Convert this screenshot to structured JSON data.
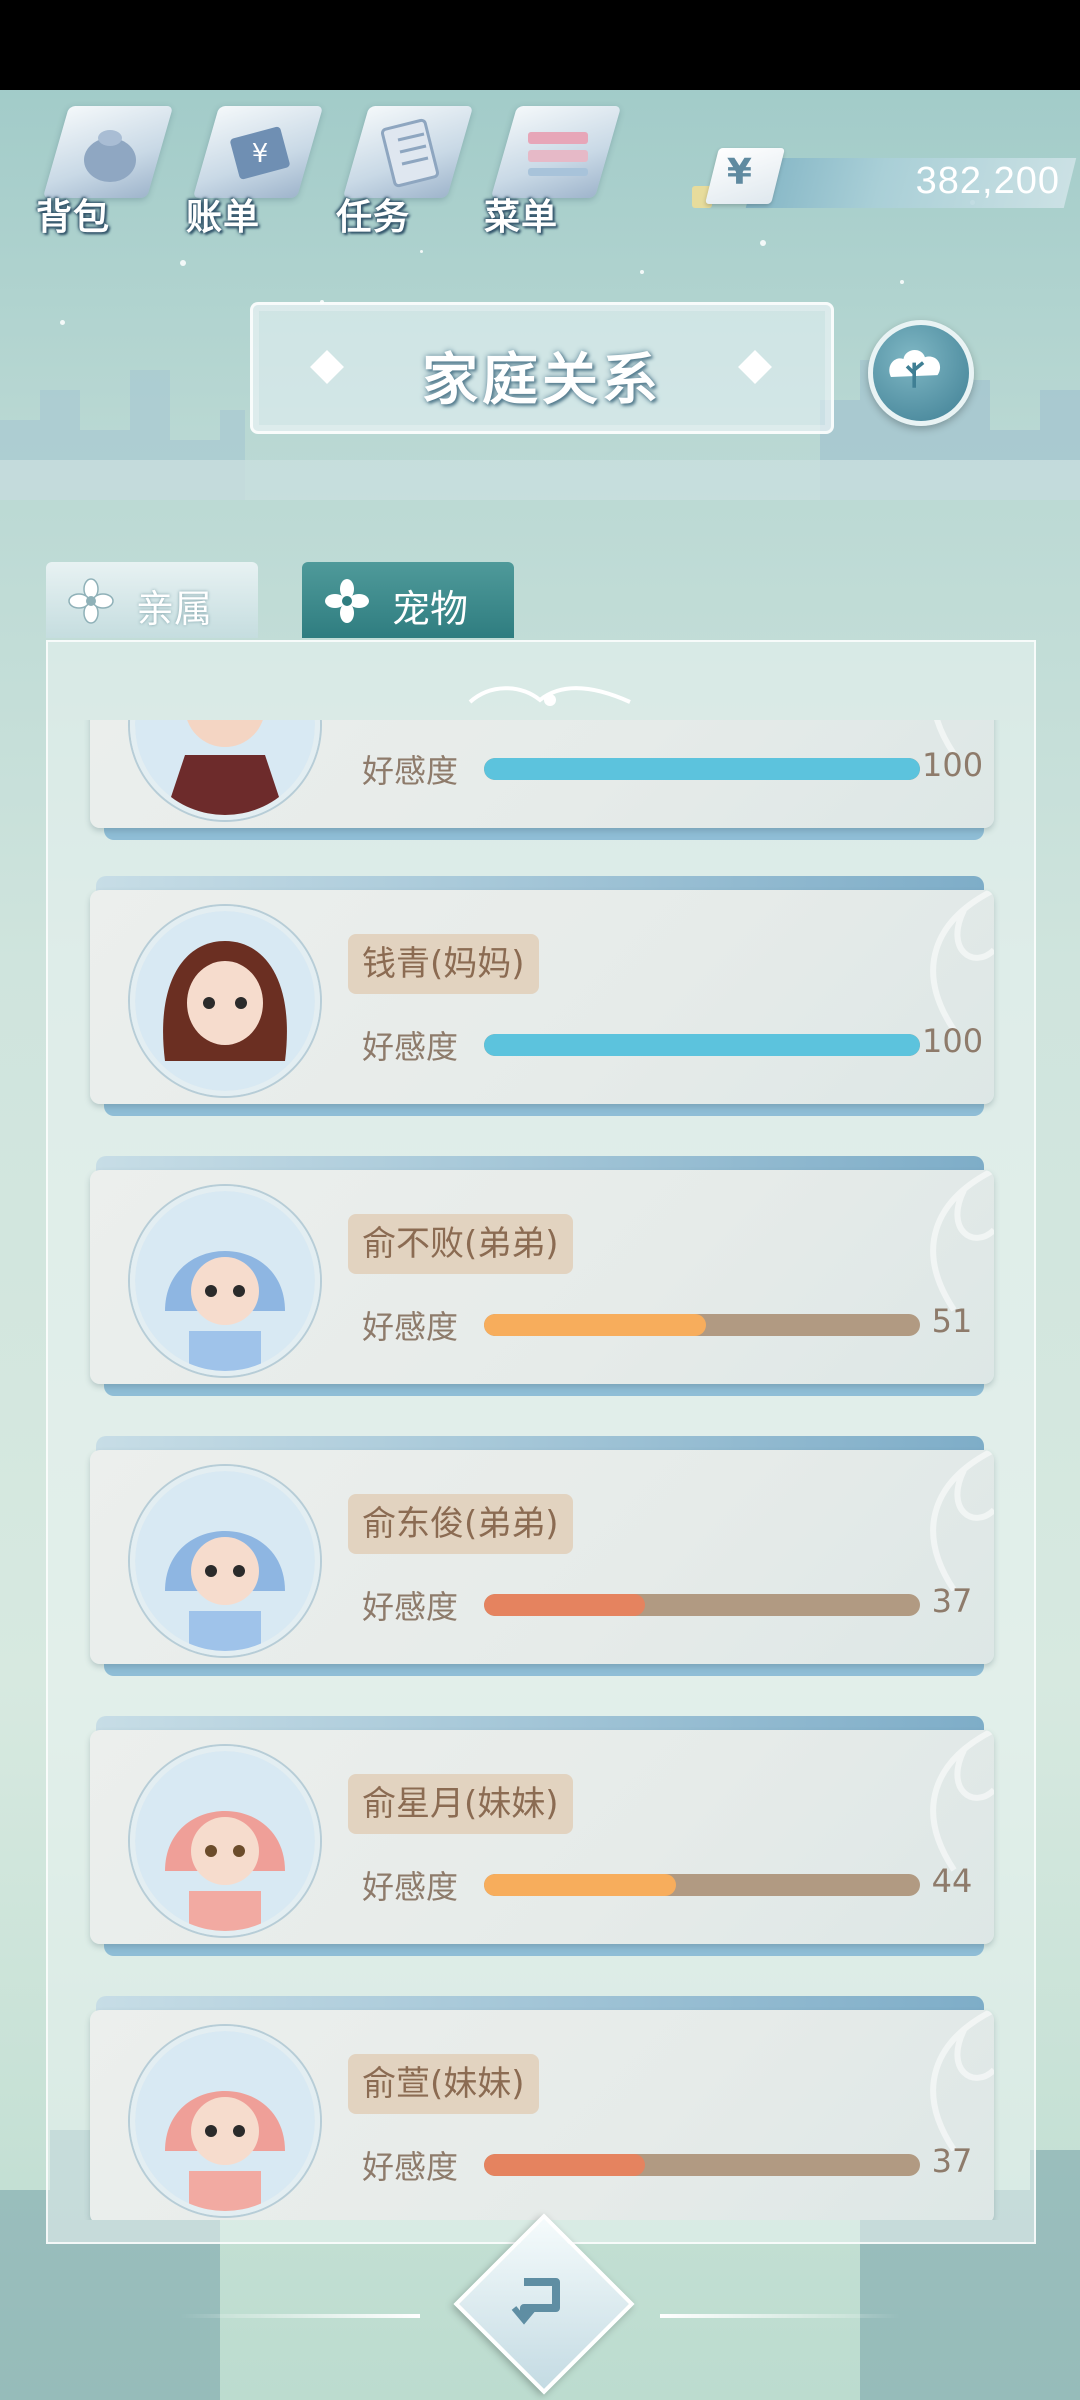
{
  "toolbar": {
    "items": [
      {
        "label": "背包",
        "icon": "bag-icon"
      },
      {
        "label": "账单",
        "icon": "bill-icon"
      },
      {
        "label": "任务",
        "icon": "task-icon"
      },
      {
        "label": "菜单",
        "icon": "menu-icon"
      }
    ]
  },
  "currency": {
    "symbol": "¥",
    "amount": "382,200"
  },
  "header": {
    "title": "家庭关系"
  },
  "tabs": [
    {
      "label": "亲属",
      "active": true
    },
    {
      "label": "宠物",
      "active": false
    }
  ],
  "affection_label": "好感度",
  "members": [
    {
      "name": "",
      "affection": 100,
      "affection_text": "100",
      "bar_color": "#5cc3dd",
      "avatar": "dad"
    },
    {
      "name": "钱青(妈妈)",
      "affection": 100,
      "affection_text": "100",
      "bar_color": "#5cc3dd",
      "avatar": "mom"
    },
    {
      "name": "俞不败(弟弟)",
      "affection": 51,
      "affection_text": "51",
      "bar_color": "#f7ad5c",
      "avatar": "blue"
    },
    {
      "name": "俞东俊(弟弟)",
      "affection": 37,
      "affection_text": "37",
      "bar_color": "#e5835f",
      "avatar": "blue"
    },
    {
      "name": "俞星月(妹妹)",
      "affection": 44,
      "affection_text": "44",
      "bar_color": "#f7ad5c",
      "avatar": "pink"
    },
    {
      "name": "俞萱(妹妹)",
      "affection": 37,
      "affection_text": "37",
      "bar_color": "#e5835f",
      "avatar": "pink"
    }
  ],
  "colors": {
    "bar_full": "#5cc3dd",
    "bar_mid": "#f7ad5c",
    "bar_low": "#e5835f",
    "bar_track": "#b19a82"
  }
}
